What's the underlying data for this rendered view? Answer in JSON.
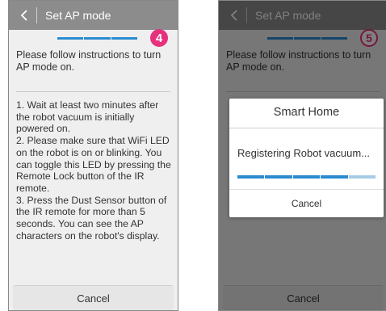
{
  "left": {
    "title": "Set AP mode",
    "step_number": "4",
    "intro": "Please follow instructions to turn AP mode on.",
    "instructions": "1. Wait at least two minutes after the robot vacuum is initially powered on.\n2. Please make sure that WiFi LED on the robot is on or blinking. You can toggle this LED by pressing the Remote Lock button of the IR remote.\n3. Press the Dust Sensor button of the IR remote for more than 5 seconds. You can see the AP characters on the robot's display.",
    "cancel_label": "Cancel",
    "progress": {
      "completed_segments": 3,
      "total_segments": 4
    }
  },
  "right": {
    "title": "Set AP mode",
    "step_number": "5",
    "intro": "Please follow instructions to turn AP mode on.",
    "cancel_label": "Cancel",
    "progress": {
      "completed_segments": 3,
      "total_segments": 4
    },
    "dialog": {
      "title": "Smart Home",
      "message": "Registering Robot vacuum...",
      "cancel_label": "Cancel",
      "progress": {
        "completed_segments": 4,
        "total_segments": 5
      }
    }
  },
  "icons": {
    "back": "chevron-left-icon"
  },
  "colors": {
    "title_bar": "#8c8c8c",
    "progress_active": "#2a8bd0",
    "progress_pending": "#a6cbe6",
    "step_badge": "#e6317d"
  }
}
